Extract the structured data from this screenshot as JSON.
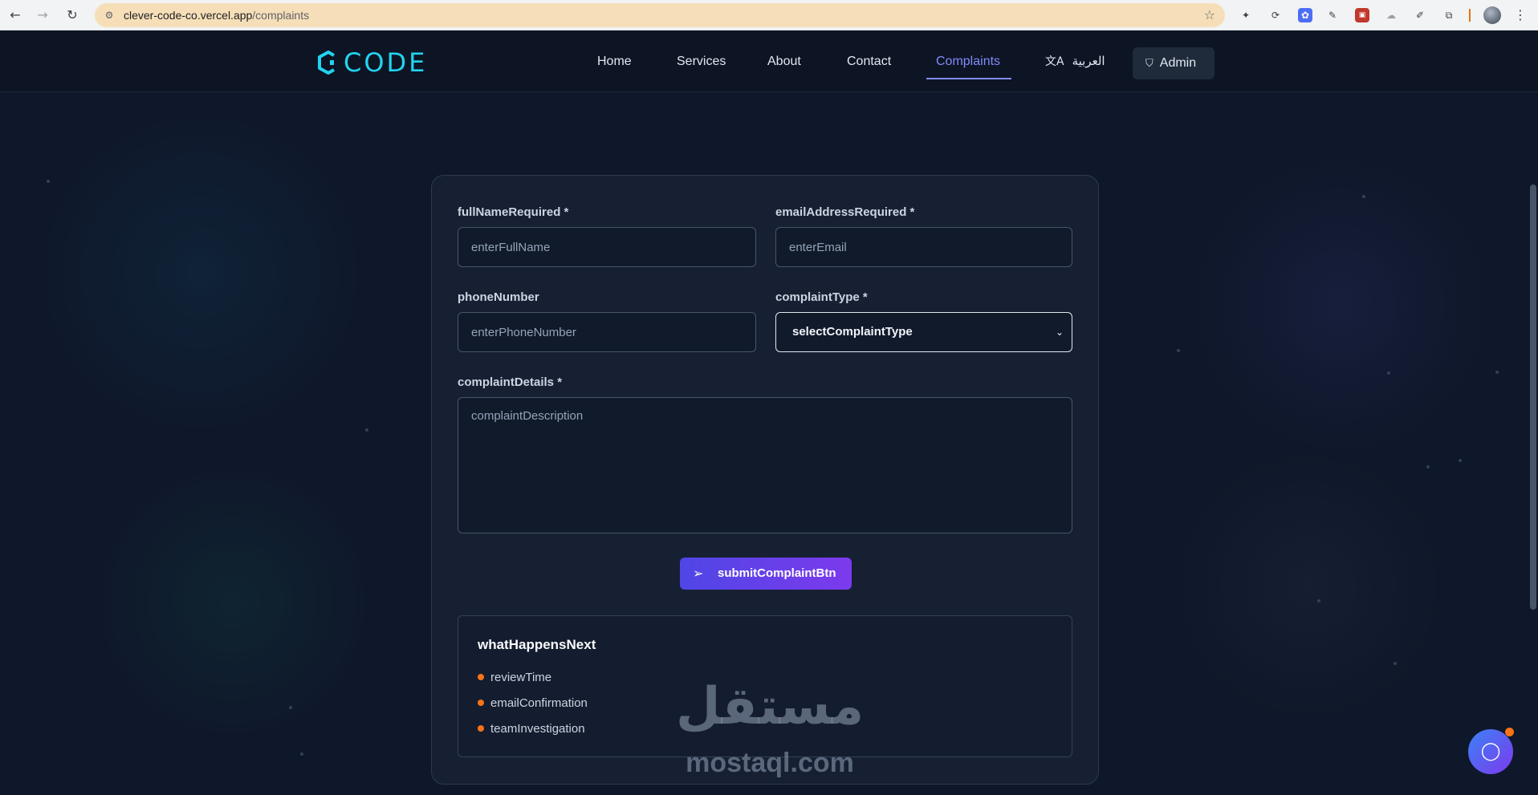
{
  "browser": {
    "url_host": "clever-code-co.vercel.app",
    "url_path": "/complaints"
  },
  "header": {
    "logo_text": "CODE",
    "nav": [
      "Home",
      "Services",
      "About",
      "Contact",
      "Complaints"
    ],
    "active_nav": "Complaints",
    "language_label": "العربية",
    "admin_label": "Admin"
  },
  "form": {
    "full_name_label": "fullNameRequired *",
    "full_name_placeholder": "enterFullName",
    "email_label": "emailAddressRequired *",
    "email_placeholder": "enterEmail",
    "phone_label": "phoneNumber",
    "phone_placeholder": "enterPhoneNumber",
    "complaint_type_label": "complaintType *",
    "complaint_type_value": "selectComplaintType",
    "details_label": "complaintDetails *",
    "details_placeholder": "complaintDescription",
    "submit_label": "submitComplaintBtn"
  },
  "next_steps": {
    "title": "whatHappensNext",
    "items": [
      "reviewTime",
      "emailConfirmation",
      "teamInvestigation"
    ]
  },
  "watermark": {
    "arabic": "مستقل",
    "latin": "mostaql.com"
  },
  "colors": {
    "accent": "#818cf8",
    "logo": "#22d3ee",
    "background": "#0f172a",
    "bullet": "#f97316"
  },
  "icons": [
    "back-icon",
    "forward-icon",
    "reload-icon",
    "site-info-icon",
    "star-icon",
    "translate-icon",
    "shield-icon",
    "send-icon",
    "chat-icon",
    "chevron-down-icon"
  ]
}
